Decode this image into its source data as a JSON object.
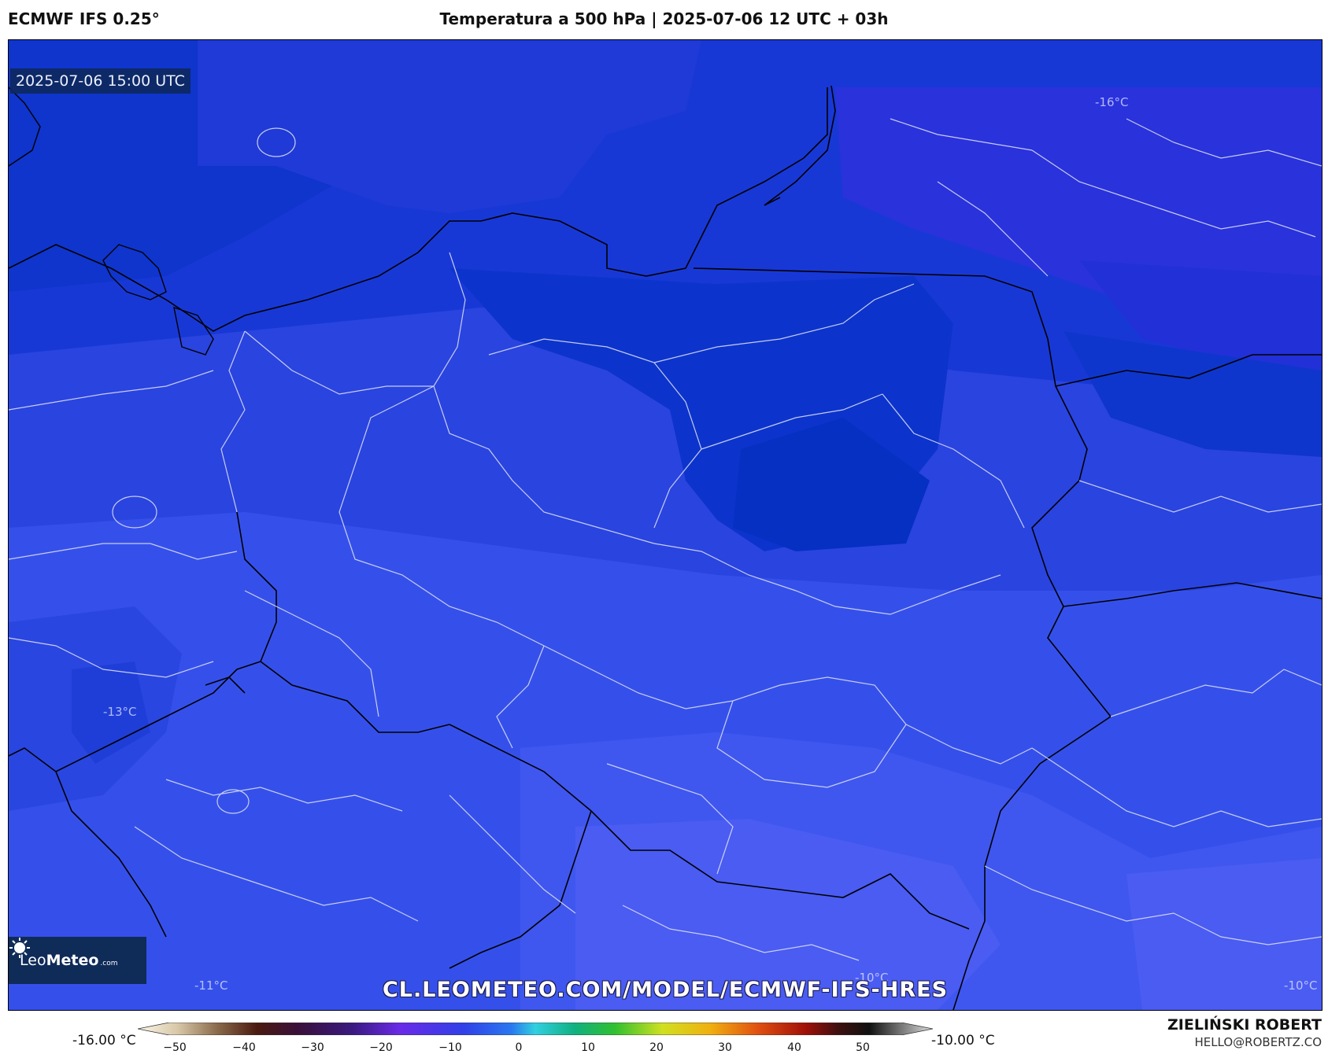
{
  "header": {
    "model": "ECMWF IFS 0.25°",
    "title": "Temperatura a 500 hPa | 2025-07-06 12 UTC + 03h"
  },
  "map": {
    "valid_time": "2025-07-06 15:00 UTC",
    "url": "CL.LEOMETEO.COM/MODEL/ECMWF-IFS-HRES",
    "isotherm_labels": [
      "-16°C",
      "-13°C",
      "-11°C",
      "-10°C",
      "-10°C"
    ],
    "fill_colors": {
      "coldest": "#0a32c8",
      "cold": "#1f3fd8",
      "mid": "#2a45e2",
      "warm": "#3a52ee",
      "warmer": "#4458f0",
      "north": "#2233dd"
    }
  },
  "logo": {
    "part1": "Leo",
    "part2": "Meteo",
    "part3": ".com"
  },
  "colorbar": {
    "min_label": "-16.00 °C",
    "max_label": "-10.00 °C",
    "ticks": [
      "−50",
      "−40",
      "−30",
      "−20",
      "−10",
      "0",
      "10",
      "20",
      "30",
      "40",
      "50"
    ]
  },
  "credit": {
    "name": "ZIELIŃSKI ROBERT",
    "email": "HELLO@ROBERTZ.CO"
  }
}
